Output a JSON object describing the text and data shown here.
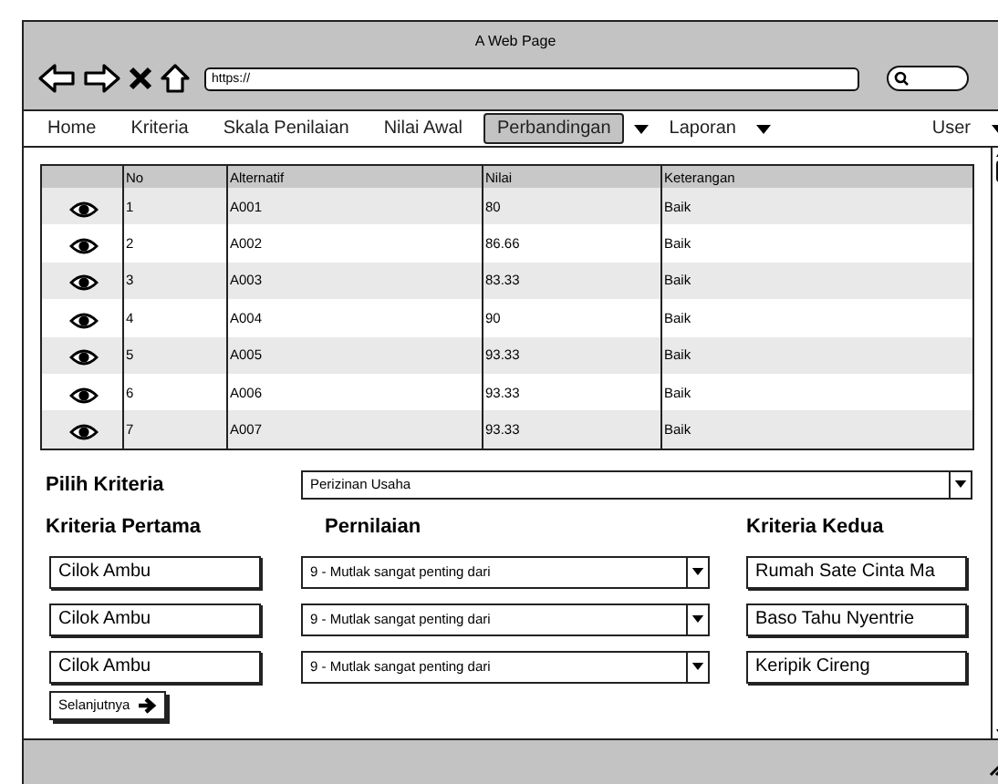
{
  "window": {
    "title": "A Web Page"
  },
  "browser": {
    "address": "https://"
  },
  "menu": [
    {
      "label": "Home",
      "selected": false,
      "kind": "link"
    },
    {
      "label": "Kriteria",
      "selected": false,
      "kind": "link"
    },
    {
      "label": "Skala Penilaian",
      "selected": false,
      "kind": "link"
    },
    {
      "label": "Nilai Awal",
      "selected": false,
      "kind": "link"
    },
    {
      "label": "Perbandingan",
      "selected": true,
      "kind": "link"
    },
    {
      "label": "Laporan",
      "selected": false,
      "kind": "dropdown-both"
    },
    {
      "label": "User",
      "selected": false,
      "kind": "dropdown"
    }
  ],
  "table": {
    "columns": [
      "No",
      "Alternatif",
      "Nilai",
      "Keterangan"
    ],
    "rows": [
      [
        "1",
        "A001",
        "80",
        "Baik"
      ],
      [
        "2",
        "A002",
        "86.66",
        "Baik"
      ],
      [
        "3",
        "A003",
        "83.33",
        "Baik"
      ],
      [
        "4",
        "A004",
        "90",
        "Baik"
      ],
      [
        "5",
        "A005",
        "93.33",
        "Baik"
      ],
      [
        "6",
        "A006",
        "93.33",
        "Baik"
      ],
      [
        "7",
        "A007",
        "93.33",
        "Baik"
      ]
    ]
  },
  "pilih_kriteria": {
    "label": "Pilih Kriteria",
    "value": "Perizinan Usaha"
  },
  "headings": [
    "Kriteria Pertama",
    "Pernilaian",
    "Kriteria Kedua"
  ],
  "comparisons": [
    {
      "first": "Cilok Ambu",
      "rating": "9 - Mutlak sangat penting dari",
      "second": "Rumah Sate Cinta Ma"
    },
    {
      "first": "Cilok Ambu",
      "rating": "9 - Mutlak sangat penting dari",
      "second": "Baso Tahu Nyentrie"
    },
    {
      "first": "Cilok Ambu",
      "rating": "9 - Mutlak sangat penting dari",
      "second": "Keripik Cireng"
    }
  ],
  "next_button": "Selanjutnya"
}
